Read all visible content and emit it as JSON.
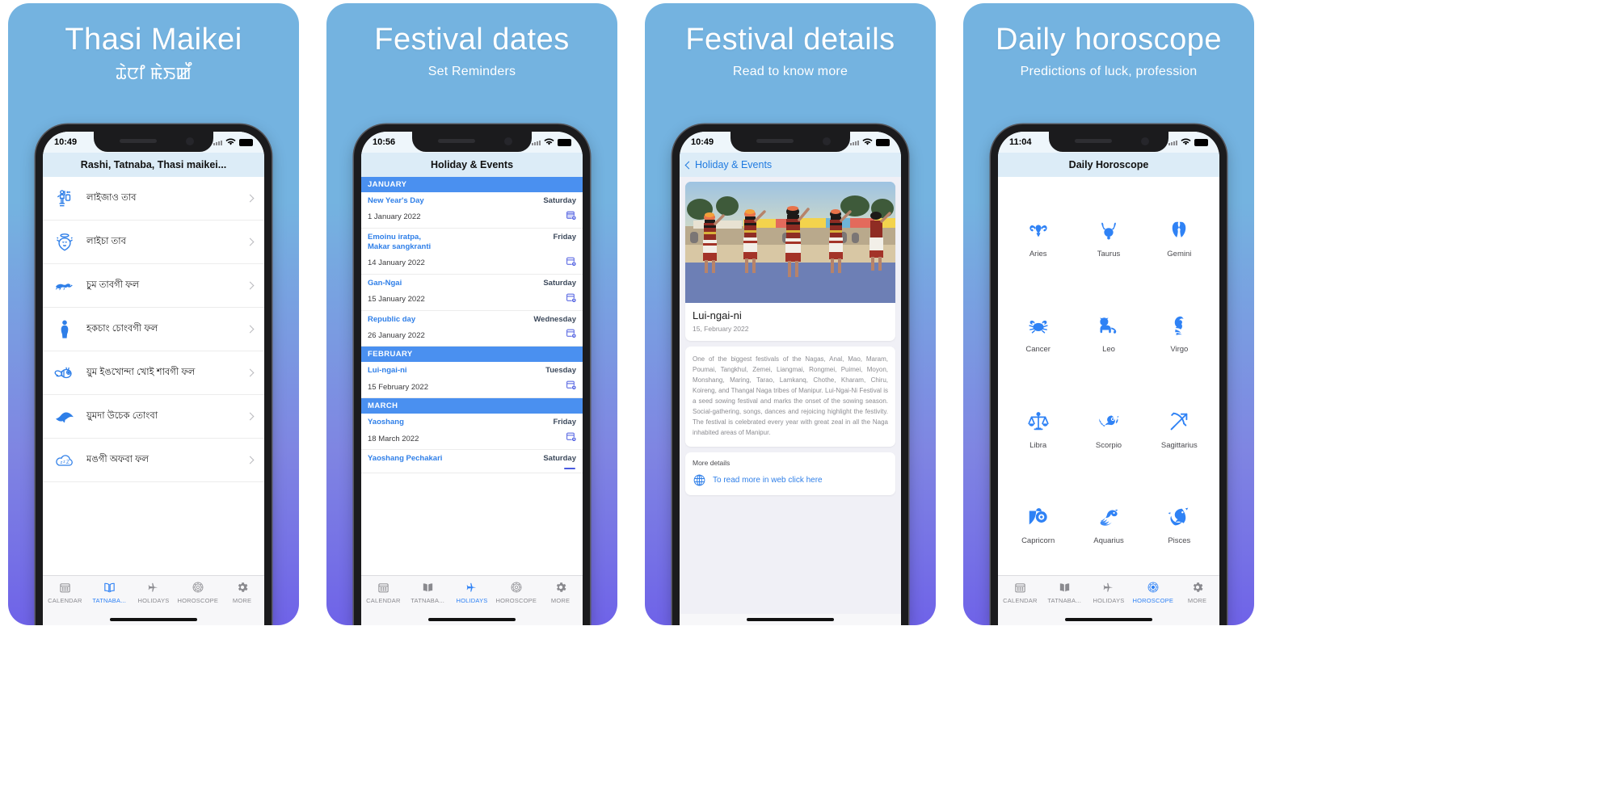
{
  "colors": {
    "accent": "#2f7fe8",
    "tab_active": "#2f82f5",
    "month_header_bg": "#4a90f0",
    "panel_gradient_top": "#74b3e0",
    "panel_gradient_bottom": "#6f63e8"
  },
  "panels": [
    {
      "title": "Thasi Maikei",
      "subtitle": "ꯊꯥꯅꯤ ꯃꯥꯏꯀꯩ",
      "subtitle_is_mtei": true,
      "status_time": "10:49",
      "nav_title": "Rashi, Tatnaba, Thasi maikei...",
      "list": [
        {
          "label": "লাইজাও  তাব",
          "icon": "deity-icon"
        },
        {
          "label": "লাইচা তাব",
          "icon": "angel-face-icon"
        },
        {
          "label": "চুম তাবগী ফল",
          "icon": "lizard-icon"
        },
        {
          "label": "হকচাং চোংবগী ফল",
          "icon": "person-icon"
        },
        {
          "label": "য়ুম ইঙখোন্দা খোই শাবগী ফল",
          "icon": "bee-icon"
        },
        {
          "label": "য়ুমদা উচেক তোংবা",
          "icon": "bird-icon"
        },
        {
          "label": "মঙগী অফবা ফল",
          "icon": "sleep-cloud-icon"
        }
      ],
      "tabs": [
        {
          "label": "CALENDAR",
          "icon": "calendar-icon",
          "active": false
        },
        {
          "label": "TATNABA...",
          "icon": "book-icon",
          "active": true
        },
        {
          "label": "HOLIDAYS",
          "icon": "airplane-icon",
          "active": false
        },
        {
          "label": "HOROSCOPE",
          "icon": "zodiac-wheel-icon",
          "active": false
        },
        {
          "label": "MORE",
          "icon": "gear-icon",
          "active": false
        }
      ]
    },
    {
      "title": "Festival dates",
      "subtitle": "Set Reminders",
      "status_time": "10:56",
      "nav_title": "Holiday & Events",
      "months": [
        {
          "name": "JANUARY",
          "events": [
            {
              "name": "New  Year's Day",
              "weekday": "Saturday",
              "date": "1 January 2022"
            },
            {
              "name": "Emoinu iratpa,\nMakar sangkranti",
              "weekday": "Friday",
              "date": "14 January 2022"
            },
            {
              "name": "Gan-Ngai",
              "weekday": "Saturday",
              "date": "15 January 2022"
            },
            {
              "name": "Republic day",
              "weekday": "Wednesday",
              "date": "26 January 2022"
            }
          ]
        },
        {
          "name": "FEBRUARY",
          "events": [
            {
              "name": "Lui-ngai-ni",
              "weekday": "Tuesday",
              "date": "15 February 2022"
            }
          ]
        },
        {
          "name": "MARCH",
          "events": [
            {
              "name": "Yaoshang",
              "weekday": "Friday",
              "date": "18 March 2022"
            },
            {
              "name": "Yaoshang Pechakari",
              "weekday": "Saturday",
              "date": ""
            }
          ]
        }
      ],
      "tabs": [
        {
          "label": "CALENDAR",
          "icon": "calendar-icon",
          "active": false
        },
        {
          "label": "TATNABA...",
          "icon": "book-icon",
          "active": false
        },
        {
          "label": "HOLIDAYS",
          "icon": "airplane-icon",
          "active": true
        },
        {
          "label": "HOROSCOPE",
          "icon": "zodiac-wheel-icon",
          "active": false
        },
        {
          "label": "MORE",
          "icon": "gear-icon",
          "active": false
        }
      ]
    },
    {
      "title": "Festival details",
      "subtitle": "Read to know more",
      "status_time": "10:49",
      "back_label": "Holiday & Events",
      "event_title": "Lui-ngai-ni",
      "event_date": "15, February 2022",
      "description": "One of the biggest festivals of the Nagas, Anal, Mao, Maram, Poumai, Tangkhul, Zemei, Liangmai, Rongmei, Puimei, Moyon, Monshang, Maring, Tarao, Lamkanq, Chothe, Kharam, Chiru, Koireng, and Thangal Naga tribes of Manipur. Lui-Ngai-Ni Festival is a seed sowing festival and marks the onset of the sowing season. Social-gathering, songs, dances and rejoicing highlight the festivity. The festival is celebrated every year with great zeal in all the Naga inhabited areas of Manipur.",
      "more_title": "More details",
      "more_link_label": "To read more in web click here",
      "tabs": [
        {
          "label": "CALENDAR",
          "icon": "calendar-icon",
          "active": false
        },
        {
          "label": "TATNABA...",
          "icon": "book-icon",
          "active": false
        },
        {
          "label": "HOLIDAYS",
          "icon": "airplane-icon",
          "active": true
        },
        {
          "label": "HOROSCOPE",
          "icon": "zodiac-wheel-icon",
          "active": false
        },
        {
          "label": "MORE",
          "icon": "gear-icon",
          "active": false
        }
      ]
    },
    {
      "title": "Daily horoscope",
      "subtitle": "Predictions of luck, profession",
      "status_time": "11:04",
      "nav_title": "Daily Horoscope",
      "zodiac": [
        {
          "label": "Aries",
          "icon": "ram-icon"
        },
        {
          "label": "Taurus",
          "icon": "bull-icon"
        },
        {
          "label": "Gemini",
          "icon": "twins-icon"
        },
        {
          "label": "Cancer",
          "icon": "crab-icon"
        },
        {
          "label": "Leo",
          "icon": "lion-icon"
        },
        {
          "label": "Virgo",
          "icon": "maiden-icon"
        },
        {
          "label": "Libra",
          "icon": "scales-icon"
        },
        {
          "label": "Scorpio",
          "icon": "scorpion-icon"
        },
        {
          "label": "Sagittarius",
          "icon": "archer-bow-icon"
        },
        {
          "label": "Capricorn",
          "icon": "goat-icon"
        },
        {
          "label": "Aquarius",
          "icon": "water-bearer-icon"
        },
        {
          "label": "Pisces",
          "icon": "fish-icon"
        }
      ],
      "tabs": [
        {
          "label": "CALENDAR",
          "icon": "calendar-icon",
          "active": false
        },
        {
          "label": "TATNABA...",
          "icon": "book-icon",
          "active": false
        },
        {
          "label": "HOLIDAYS",
          "icon": "airplane-icon",
          "active": false
        },
        {
          "label": "HOROSCOPE",
          "icon": "zodiac-wheel-icon",
          "active": true
        },
        {
          "label": "MORE",
          "icon": "gear-icon",
          "active": false
        }
      ]
    }
  ]
}
